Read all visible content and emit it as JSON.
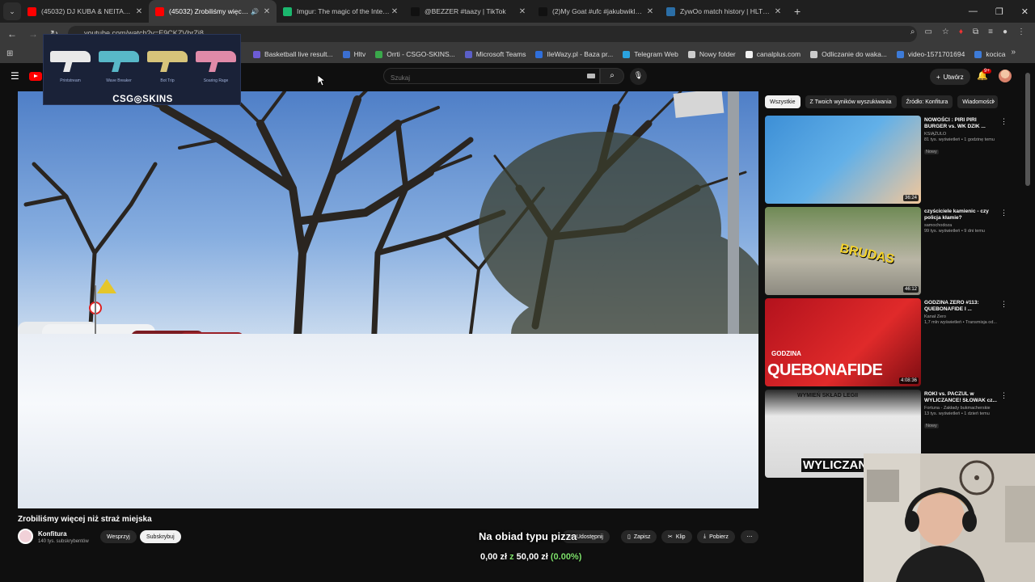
{
  "browser": {
    "tabs": [
      {
        "title": "(45032) DJ KUBA & NEITAN - P",
        "favicon_color": "#ff0000",
        "active": false
      },
      {
        "title": "(45032) Zrobiliśmy więcej n",
        "favicon_color": "#ff0000",
        "active": true
      },
      {
        "title": "Imgur: The magic of the Interne",
        "favicon_color": "#1bb76e",
        "active": false
      },
      {
        "title": "@BEZZER #taazy | TikTok",
        "favicon_color": "#111111",
        "active": false
      },
      {
        "title": "(2)My Goat #ufc #jakubwiklacz",
        "favicon_color": "#111111",
        "active": false
      },
      {
        "title": "ZywOo match history | HLTV.org",
        "favicon_color": "#2b6ea6",
        "active": false
      }
    ],
    "url": "youtube.com/watch?v=E9CKZVbrZi8",
    "bookmarks": [
      {
        "label": "Basketball live result...",
        "color": "#6d5cd6"
      },
      {
        "label": "Hltv",
        "color": "#3b6fd1"
      },
      {
        "label": "Orrti - CSGO-SKINS...",
        "color": "#3aa84b"
      },
      {
        "label": "Microsoft Teams",
        "color": "#5b5fc7"
      },
      {
        "label": "IleWazy.pl - Baza pr...",
        "color": "#2f6fdb"
      },
      {
        "label": "Telegram Web",
        "color": "#2aa3e0"
      },
      {
        "label": "Nowy folder",
        "color": "#cccccc"
      },
      {
        "label": "canalplus.com",
        "color": "#f1f1f1"
      },
      {
        "label": "Odliczanie do waka...",
        "color": "#cccccc"
      },
      {
        "label": "video-1571701694",
        "color": "#3d7bd8"
      },
      {
        "label": "kocica",
        "color": "#3d7bd8"
      }
    ]
  },
  "youtube": {
    "search_placeholder": "Szukaj",
    "create_label": "Utwórz",
    "notifications": "9+",
    "video_title": "Zrobiliśmy więcej niż straż miejska",
    "channel_name": "Konfitura",
    "channel_subs": "140 tys. subskrybentów",
    "support_label": "Wesprzyj",
    "subscribe_label": "Subskrybuj",
    "share_label": "Udostępnij",
    "save_label": "Zapisz",
    "clip_label": "Klip",
    "download_label": "Pobierz",
    "chips": [
      "Wszystkie",
      "Z Twoich wyników wyszukiwania",
      "Źródło: Konfitura",
      "Wiadomości"
    ],
    "recommendations": [
      {
        "title": "NOWOŚCI : PIRI PIRI BURGER vs. WK DZIK ...",
        "channel": "KSIĄŻULO",
        "meta": "81 tys. wyświetleń • 1 godzinę temu",
        "badge": "Nowy",
        "duration": "36:24"
      },
      {
        "title": "czyściciele kamienic - czy policja kłamie?",
        "channel": "samochodoza",
        "meta": "99 tys. wyświetleń • 9 dni temu",
        "badge": "",
        "duration": "46:12",
        "thumb_text": "BRUDAS"
      },
      {
        "title": "GODZINA ZERO #113: QUEBONAFIDE I ...",
        "channel": "Kanał Zero",
        "meta": "1,7 mln wyświetleń • Transmisja od...",
        "badge": "",
        "duration": "4:08:36",
        "thumb_text": "QUEBONAFIDE",
        "thumb_sub": "GODZINA"
      },
      {
        "title": "ROKI vs. PACZUL w WYLICZANCE! SŁOWAK cz...",
        "channel": "Fortuna - Zakłady bukmacherskie",
        "meta": "13 tys. wyświetleń • 1 dzień temu",
        "badge": "Nowy",
        "duration": "",
        "thumb_text": "WYLICZAN",
        "thumb_top": "WYMIEŃ SKŁAD LEGII"
      }
    ]
  },
  "ad": {
    "guns": [
      "Printstream",
      "Wave Breaker",
      "Bot Trip",
      "Soaring Rage"
    ],
    "gun_colors": [
      "#e9e9e9",
      "#58b8c8",
      "#d7c47a",
      "#e08aa8"
    ],
    "logo": "CSG◎SKINS"
  },
  "stream_overlay": {
    "text": "Na obiad typu pizza",
    "donation_current": "0,00 zł",
    "donation_sep": "z",
    "donation_goal": "50,00 zł",
    "donation_pct": "(0.00%)"
  }
}
